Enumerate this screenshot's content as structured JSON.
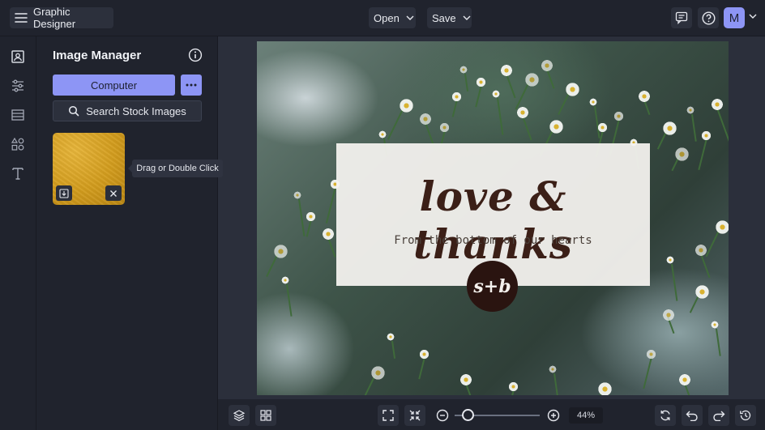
{
  "app": {
    "title": "Graphic Designer",
    "accent_color": "#8d95f5"
  },
  "topbar": {
    "open_label": "Open",
    "save_label": "Save",
    "avatar_initial": "M",
    "icons": [
      "hamburger-icon",
      "chevron-down-icon",
      "comment-icon",
      "help-icon"
    ]
  },
  "rail": {
    "items": [
      {
        "name": "image-manager",
        "icon": "image-icon"
      },
      {
        "name": "adjustments",
        "icon": "sliders-icon"
      },
      {
        "name": "backgrounds",
        "icon": "layout-icon"
      },
      {
        "name": "graphics",
        "icon": "shapes-icon"
      },
      {
        "name": "text",
        "icon": "text-icon"
      }
    ]
  },
  "panel": {
    "title": "Image Manager",
    "computer_label": "Computer",
    "stock_label": "Search Stock Images",
    "tooltip": "Drag or Double Click"
  },
  "canvas": {
    "title": "love & thanks",
    "subtitle": "From the bottom of our hearts",
    "monogram": "s+b"
  },
  "bottombar": {
    "zoom": "44%",
    "zoom_level_fraction": 0.1
  }
}
